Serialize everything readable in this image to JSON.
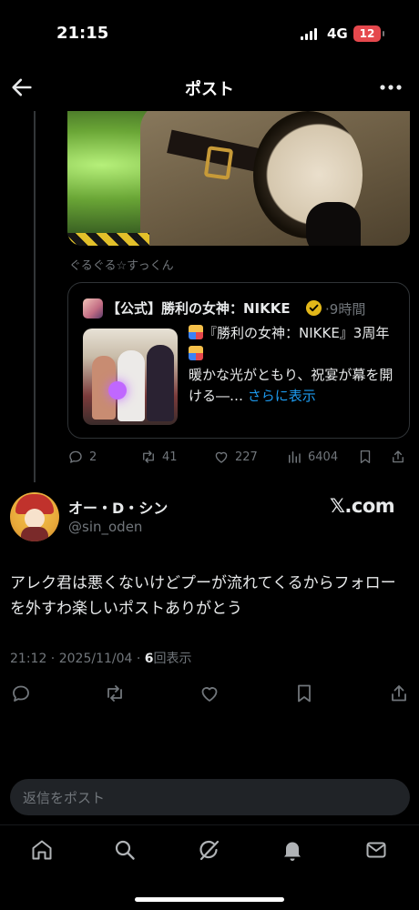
{
  "status_bar": {
    "time": "21:15",
    "network": "4G",
    "battery": "12"
  },
  "header": {
    "title": "ポスト"
  },
  "previous_post": {
    "attribution": "ぐるぐる☆すっくん",
    "quote": {
      "author": "【公式】勝利の女神：NIKKE",
      "time": "9時間",
      "text_line1": "『勝利の女神：NIKKE』3周年",
      "text_line2": "暖かな光がともり、祝宴が幕を開ける―…",
      "more_label": "さらに表示"
    },
    "stats": {
      "replies": "2",
      "reposts": "41",
      "likes": "227",
      "views": "6404"
    }
  },
  "main_post": {
    "author_name": "オー・D・シン",
    "author_handle": "@sin_oden",
    "source_label": "𝕏.com",
    "body": "アレク君は悪くないけどプーが流れてくるからフォローを外すわ楽しいポストありがとう",
    "time": "21:12",
    "date": "2025/11/04",
    "views_count": "6",
    "views_label": "回表示"
  },
  "reply_bar": {
    "placeholder": "返信をポスト"
  },
  "icons": {
    "back": "arrow-left-icon",
    "more": "more-dots-icon",
    "reply": "reply-icon",
    "repost": "repost-icon",
    "like": "heart-icon",
    "views": "views-icon",
    "bookmark": "bookmark-icon",
    "share": "share-icon",
    "nav": [
      "home-icon",
      "search-icon",
      "grok-icon",
      "notifications-icon",
      "messages-icon"
    ]
  },
  "colors": {
    "background": "#000000",
    "accent": "#1d9bf0",
    "muted": "#71767b",
    "verified": "#e2b719"
  }
}
